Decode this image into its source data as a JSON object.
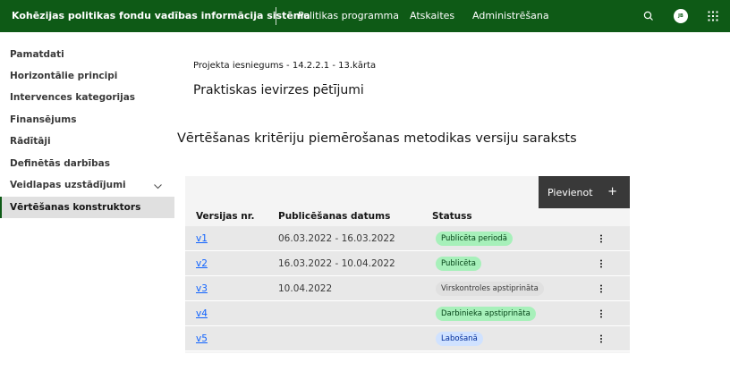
{
  "header": {
    "app_title": "Kohēzijas politikas fondu vadības informācija sistēma",
    "nav": [
      "Politikas programma",
      "Atskaites",
      "Administrēšana"
    ],
    "avatar_initials": "JB",
    "icons": [
      "search-icon",
      "avatar",
      "app-switcher-icon"
    ],
    "brand_color": "#0e5a16"
  },
  "sidebar": {
    "items": [
      {
        "label": "Pamatdati"
      },
      {
        "label": "Horizontālie principi"
      },
      {
        "label": "Intervences kategorijas"
      },
      {
        "label": "Finansējums"
      },
      {
        "label": "Rādītāji"
      },
      {
        "label": "Definētās darbības"
      },
      {
        "label": "Veidlapas uzstādījumi",
        "has_chevron": true
      },
      {
        "label": "Vērtēšanas konstruktors",
        "active": true
      }
    ]
  },
  "main": {
    "breadcrumb": "Projekta iesniegums - 14.2.2.1 - 13.kārta",
    "project_title": "Praktiskas ievirzes pētījumi",
    "section_title": "Vērtēšanas kritēriju piemērošanas metodikas versiju saraksts",
    "add_button": "Pievienot",
    "add_icon": "+",
    "columns": [
      "Versijas nr.",
      "Publicēšanas datums",
      "Statuss"
    ],
    "rows": [
      {
        "version": "v1",
        "date": "06.03.2022 - 16.03.2022",
        "status": "Publicēta periodā",
        "status_color": "#a7f0ba"
      },
      {
        "version": "v2",
        "date": "16.03.2022 - 10.04.2022",
        "status": "Publicēta",
        "status_color": "#a7f0ba"
      },
      {
        "version": "v3",
        "date": "10.04.2022",
        "status": "Virskontroles apstiprināta",
        "status_color": "#e0e0e0"
      },
      {
        "version": "v4",
        "date": "",
        "status": "Darbinieka apstiprināta",
        "status_color": "#a7f0ba"
      },
      {
        "version": "v5",
        "date": "",
        "status": "Labošanā",
        "status_color": "#d0e2ff"
      }
    ]
  }
}
